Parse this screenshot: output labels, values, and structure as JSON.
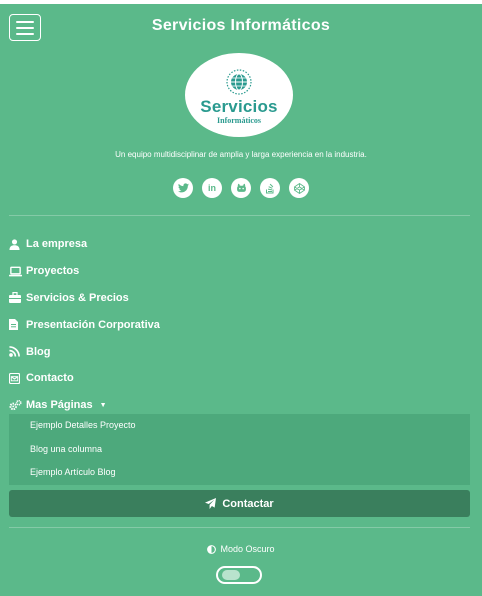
{
  "header": {
    "title": "Servicios Informáticos",
    "menu_icon": "hamburger-icon"
  },
  "logo": {
    "line1": "Servicios",
    "line2": "Informáticos",
    "icon": "globe-icon",
    "accent": "#2a9a8f"
  },
  "tagline": "Un equipo multidisciplinar de amplia y larga experiencia en la industria.",
  "social": [
    {
      "name": "twitter-icon",
      "glyph": "t"
    },
    {
      "name": "linkedin-icon",
      "glyph": "in"
    },
    {
      "name": "github-icon",
      "glyph": "g"
    },
    {
      "name": "stackoverflow-icon",
      "glyph": "s"
    },
    {
      "name": "codepen-icon",
      "glyph": "c"
    }
  ],
  "nav": {
    "items": [
      {
        "label": "La empresa",
        "icon": "user-icon"
      },
      {
        "label": "Proyectos",
        "icon": "laptop-icon"
      },
      {
        "label": "Servicios & Precios",
        "icon": "briefcase-icon"
      },
      {
        "label": "Presentación Corporativa",
        "icon": "file-icon"
      },
      {
        "label": "Blog",
        "icon": "blog-icon"
      },
      {
        "label": "Contacto",
        "icon": "envelope-icon"
      },
      {
        "label": "Mas Páginas",
        "icon": "cogs-icon"
      }
    ],
    "submenu": [
      "Ejemplo Detalles Proyecto",
      "Blog una columna",
      "Ejemplo Artículo Blog"
    ]
  },
  "contact_button": {
    "label": "Contactar",
    "icon": "paper-plane-icon"
  },
  "dark_mode": {
    "label": "Modo Oscuro",
    "icon": "half-circle-icon",
    "enabled": false
  },
  "colors": {
    "background": "#5bb98a",
    "button": "#3a7f5d",
    "submenu": "#4da97c"
  }
}
